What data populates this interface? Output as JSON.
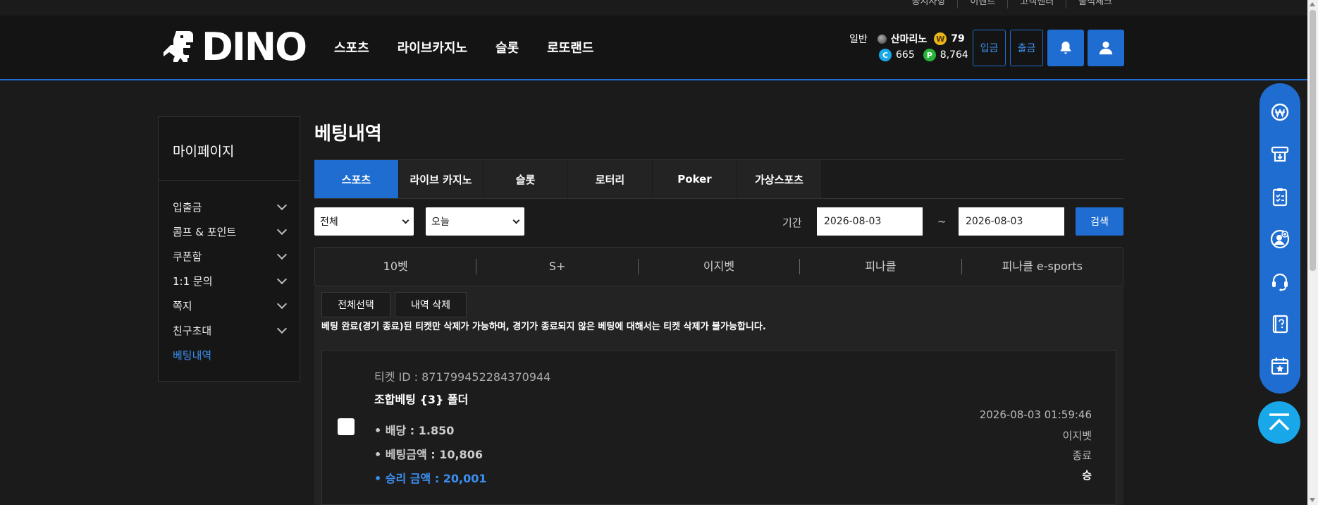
{
  "top_links": [
    "공지사항",
    "이벤트",
    "고객센터",
    "출석체크"
  ],
  "logo_text": "DINO",
  "nav": [
    "스포츠",
    "라이브카지노",
    "슬롯",
    "로또랜드"
  ],
  "user": {
    "level": "일반",
    "name": "산마리노",
    "w_coin_label": "W",
    "w_value": "79",
    "c_coin_label": "C",
    "c_value": "665",
    "p_coin_label": "P",
    "p_value": "8,764"
  },
  "header_buttons": {
    "deposit": "입금",
    "withdraw": "출금"
  },
  "sidebar": {
    "title": "마이페이지",
    "items": [
      {
        "label": "입출금"
      },
      {
        "label": "콤프 & 포인트"
      },
      {
        "label": "쿠폰함"
      },
      {
        "label": "1:1 문의"
      },
      {
        "label": "쪽지"
      },
      {
        "label": "친구초대"
      },
      {
        "label": "베팅내역"
      }
    ]
  },
  "main": {
    "title": "베팅내역",
    "tabs": [
      "스포츠",
      "라이브 카지노",
      "슬롯",
      "로터리",
      "Poker",
      "가상스포츠"
    ],
    "filter": {
      "type_select": "전체",
      "range_select": "오늘",
      "period_label": "기간",
      "date_from": "2026-08-03",
      "tilde": "~",
      "date_to": "2026-08-03",
      "search_label": "검색"
    },
    "providers": [
      "10벳",
      "S+",
      "이지벳",
      "피나클",
      "피나클 e-sports"
    ],
    "actions": {
      "select_all": "전체선택",
      "delete": "내역 삭제"
    },
    "notice": "베팅 완료(경기 종료)된 티켓만 삭제가 가능하며, 경기가 종료되지 않은 베팅에 대해서는 티켓 삭제가 불가능합니다.",
    "ticket": {
      "id_text": "티켓 ID : 871799452284370944",
      "type_text": "조합베팅 {3} 폴더",
      "odds_text": "• 배당 : 1.850",
      "amount_text": "• 베팅금액 : 10,806",
      "win_text": "• 승리 금액 : 20,001",
      "datetime": "2026-08-03 01:59:46",
      "provider": "이지벳",
      "status": "종료",
      "result": "승"
    }
  },
  "colors": {
    "accent": "#1f6dd0",
    "top_button": "#18a7e8"
  }
}
